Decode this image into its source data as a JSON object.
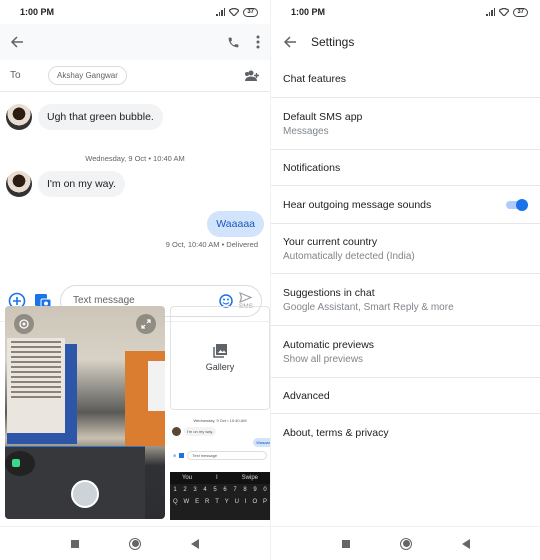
{
  "status_bar": {
    "time": "1:00 PM",
    "battery": "37"
  },
  "conversation": {
    "to_label": "To",
    "recipient": "Akshay Gangwar",
    "messages": [
      {
        "direction": "incoming",
        "text": "Ugh that green bubble."
      },
      {
        "type": "date_divider",
        "text": "Wednesday, 9 Oct • 10:40 AM"
      },
      {
        "direction": "incoming",
        "text": "I'm on my way."
      },
      {
        "direction": "outgoing",
        "text": "Waaaaa",
        "status": "9 Oct, 10:40 AM • Delivered"
      }
    ],
    "compose": {
      "placeholder": "Text message",
      "send_label": "SMS"
    },
    "attachments": {
      "gallery_label": "Gallery"
    },
    "thumbnail": {
      "date": "Wednesday, 9 Oct • 10:40 AM",
      "message": "I'm on my way.",
      "sent": "Waaaaa",
      "placeholder": "Text message",
      "suggestions": [
        "You",
        "I",
        "Swipe"
      ],
      "number_row": [
        "1",
        "2",
        "3",
        "4",
        "5",
        "6",
        "7",
        "8",
        "9",
        "0"
      ],
      "letter_row": [
        "Q",
        "W",
        "E",
        "R",
        "T",
        "Y",
        "U",
        "I",
        "O",
        "P"
      ]
    }
  },
  "settings": {
    "title": "Settings",
    "items": [
      {
        "title": "Chat features"
      },
      {
        "title": "Default SMS app",
        "subtitle": "Messages"
      },
      {
        "title": "Notifications"
      },
      {
        "title": "Hear outgoing message sounds",
        "toggle": true
      },
      {
        "title": "Your current country",
        "subtitle": "Automatically detected (India)"
      },
      {
        "title": "Suggestions in chat",
        "subtitle": "Google Assistant, Smart Reply & more"
      },
      {
        "title": "Automatic previews",
        "subtitle": "Show all previews"
      },
      {
        "title": "Advanced"
      },
      {
        "title": "About, terms & privacy"
      }
    ]
  },
  "colors": {
    "accent": "#1a73e8",
    "sent_bubble": "#d2e3fc",
    "received_bubble": "#f1f3f4"
  }
}
